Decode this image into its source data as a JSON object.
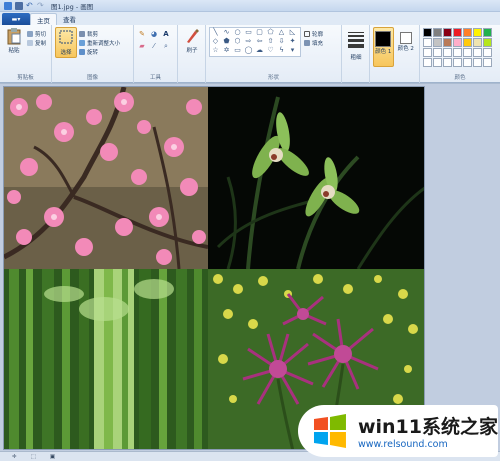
{
  "window": {
    "title": "图1.jpg - 画图"
  },
  "quick_access": {
    "icons": [
      "paint-app-icon",
      "save-icon",
      "undo-icon",
      "redo-icon"
    ]
  },
  "tabs": [
    {
      "label": "主页",
      "active": true
    },
    {
      "label": "查看",
      "active": false
    }
  ],
  "ribbon": {
    "clipboard": {
      "label": "剪贴板",
      "paste": "粘贴",
      "cut": "剪切",
      "copy": "复制"
    },
    "image": {
      "label": "图像",
      "select": "选择",
      "crop": "裁剪",
      "resize": "重新调整大小",
      "rotate": "旋转"
    },
    "tools": {
      "label": "工具"
    },
    "brushes": {
      "label": "刷子"
    },
    "shapes": {
      "label": "形状",
      "outline": "轮廓",
      "fill": "填充"
    },
    "size": {
      "label": "粗细"
    },
    "color1": {
      "label": "颜色 1",
      "color": "#000000"
    },
    "color2": {
      "label": "颜色 2",
      "color": "#ffffff"
    },
    "colors": {
      "label": "颜色",
      "palette": [
        "#000000",
        "#7f7f7f",
        "#880015",
        "#ed1c24",
        "#ff7f27",
        "#fff200",
        "#22b14c",
        "#ffffff",
        "#c3c3c3",
        "#b97a57",
        "#ffaec9",
        "#ffc90e",
        "#efe4b0",
        "#b5e61d",
        "#ffffff",
        "#ffffff",
        "#ffffff",
        "#ffffff",
        "#ffffff",
        "#ffffff",
        "#ffffff",
        "#ffffff",
        "#ffffff",
        "#ffffff",
        "#ffffff",
        "#ffffff",
        "#ffffff",
        "#ffffff"
      ]
    }
  },
  "watermark": {
    "title": "win11系统之家",
    "url": "www.relsound.com"
  }
}
